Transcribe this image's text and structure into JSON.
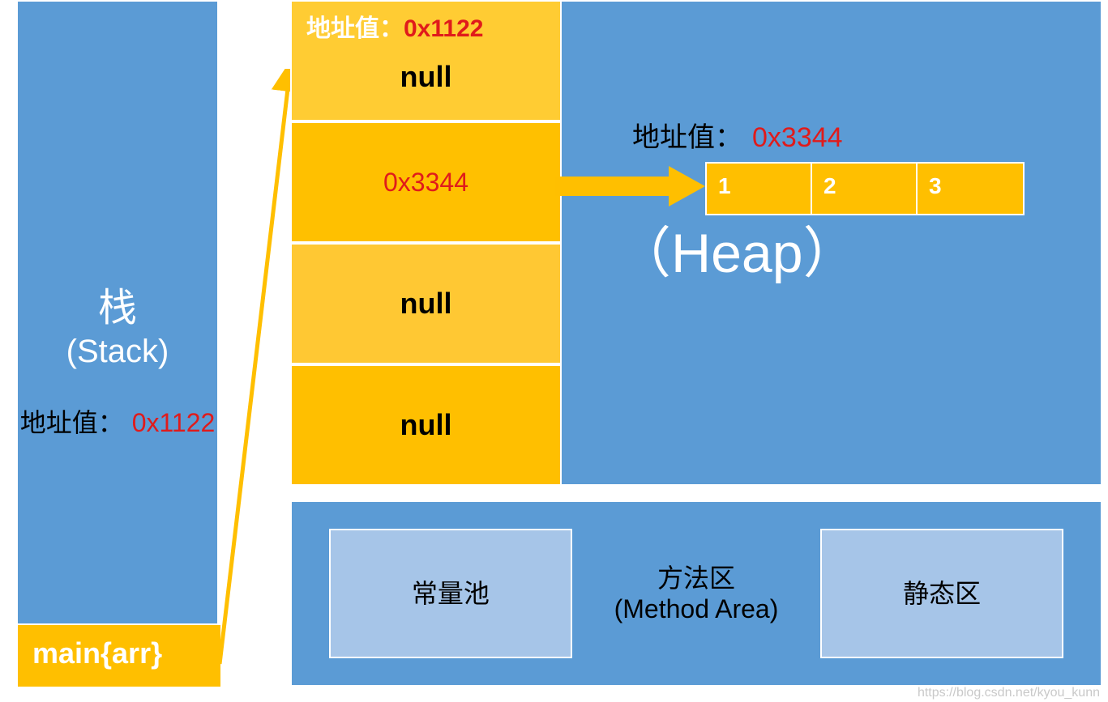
{
  "stack": {
    "title_cn": "栈",
    "title_en": "(Stack)",
    "addr_label": "地址值：",
    "addr_value": "0x1122",
    "main_label": "main{arr}"
  },
  "heap": {
    "array_addr_label": "地址值：",
    "array_addr_value": "0x1122",
    "cells": [
      "null",
      "0x3344",
      "null",
      "null"
    ],
    "inner_addr_label": "地址值：",
    "inner_addr_value": "0x3344",
    "inner_values": [
      "1",
      "2",
      "3"
    ],
    "heap_label": "（Heap）"
  },
  "method_area": {
    "constant_pool": "常量池",
    "title_cn": "方法区",
    "title_en": "(Method Area)",
    "static_area": "静态区"
  },
  "watermark": "https://blog.csdn.net/kyou_kunn"
}
